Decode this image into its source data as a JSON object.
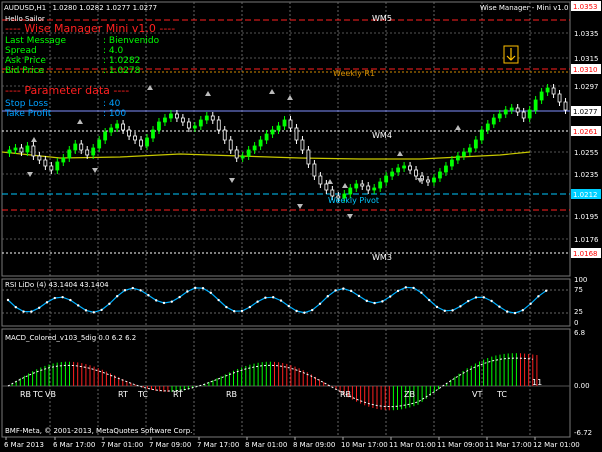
{
  "window": {
    "title": "AUDUSD,H1",
    "ohlc": "1.0280 1.0282 1.0277 1.0277",
    "indicator_tag": "Wise Manager - Mini v1.0"
  },
  "info": {
    "hello": "Hello Sailor",
    "header": "---- Wise Manager Mini v1.0 ----",
    "rows": [
      {
        "label": "Last Message",
        "value": ": Bienvenido"
      },
      {
        "label": "Spread",
        "value": ": 4.0"
      },
      {
        "label": "Ask Price",
        "value": ": 1.0282"
      },
      {
        "label": "Bid Price",
        "value": ": 1.0278"
      }
    ],
    "param_header": "---- Parameter data ----",
    "params": [
      {
        "label": "Stop Loss",
        "value": ": 40"
      },
      {
        "label": "Take Profit",
        "value": ": 100"
      }
    ]
  },
  "levels": {
    "wm5": "WM5",
    "weekly_r1": "Weekly R1",
    "wm4": "WM4",
    "weekly_pivot": "Weekly Pivot",
    "wm3": "WM3"
  },
  "price_axis": {
    "ticks": [
      "1.0335",
      "1.0315",
      "1.0297",
      "1.0276",
      "1.0255",
      "1.0235",
      "1.0195",
      "1.0176"
    ],
    "boxes": [
      {
        "value": "1.0353",
        "bg": "#ffffff",
        "fg": "#ff0000"
      },
      {
        "value": "1.0310",
        "bg": "#ffffff",
        "fg": "#ff0000"
      },
      {
        "value": "1.0277",
        "bg": "#ffffff",
        "fg": "#000000"
      },
      {
        "value": "1.0261",
        "bg": "#ffffff",
        "fg": "#ff0000"
      },
      {
        "value": "1.0212",
        "bg": "#00d0ff",
        "fg": "#ffffff"
      },
      {
        "value": "1.0168",
        "bg": "#ffffff",
        "fg": "#ff0000"
      }
    ]
  },
  "rsi": {
    "title": "RSI LiDo (4) 43.1404 43.1404",
    "ticks": [
      "100",
      "75",
      "25",
      "0"
    ]
  },
  "macd": {
    "title": "MACD_Colored_v103_5dig 0.0 6.2 6.2",
    "ticks": [
      "6.8",
      "0.00",
      "-6.72"
    ],
    "labels": [
      "RB",
      "TC",
      "VB",
      "RT",
      "TC",
      "RT",
      "RB",
      "RB",
      "ZB",
      "VT",
      "TC",
      "11"
    ]
  },
  "time_axis": [
    "6 Mar 2013",
    "6 Mar 17:00",
    "7 Mar 01:00",
    "7 Mar 09:00",
    "7 Mar 17:00",
    "8 Mar 01:00",
    "8 Mar 09:00",
    "10 Mar 17:00",
    "11 Mar 01:00",
    "11 Mar 09:00",
    "11 Mar 17:00",
    "12 Mar 01:00"
  ],
  "copyright": "BMF-Meta, © 2001-2013, MetaQuotes Software Corp.",
  "colors": {
    "bull": "#00ff00",
    "bear": "#ffffff",
    "ma": "#c8c800",
    "info": "#00ff00",
    "header_red": "#ff2020",
    "param_blue": "#00a0ff",
    "rsi": "#00b0ff",
    "macd_up": "#00ff00",
    "macd_down": "#ff2020",
    "level_red": "#ff0000",
    "level_cyan": "#00c8ff",
    "level_orange": "#ffa000"
  }
}
